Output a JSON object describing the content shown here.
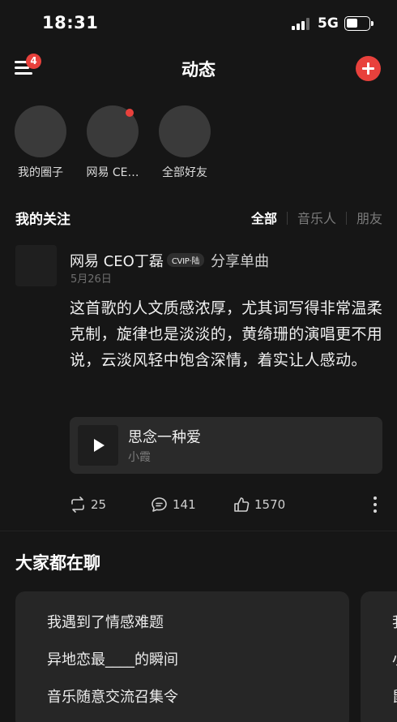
{
  "status_bar": {
    "time": "18:31",
    "network": "5G"
  },
  "header": {
    "title": "动态",
    "notification_count": "4"
  },
  "circles": [
    {
      "label": "我的圈子",
      "has_dot": false
    },
    {
      "label": "网易 CE…",
      "has_dot": true
    },
    {
      "label": "全部好友",
      "has_dot": false
    }
  ],
  "following": {
    "title": "我的关注",
    "filters": [
      "全部",
      "音乐人",
      "朋友"
    ],
    "active_filter": "全部"
  },
  "post": {
    "author": "网易 CEO丁磊",
    "vip_tag": "CVIP·陆",
    "action": "分享单曲",
    "date": "5月26日",
    "text": "这首歌的人文质感浓厚，尤其词写得非常温柔克制，旋律也是淡淡的，黄绮珊的演唱更不用说，云淡风轻中饱含深情，着实让人感动。",
    "song": {
      "title": "思念一种爱",
      "artist": "小霞"
    },
    "reposts": "25",
    "comments": "141",
    "likes": "1570"
  },
  "chat_section": {
    "title": "大家都在聊",
    "topics": [
      "我遇到了情感难题",
      "异地恋最____的瞬间",
      "音乐随意交流召集令"
    ],
    "second_card_fragments": [
      "我",
      "小",
      "鼠"
    ]
  },
  "colors": {
    "accent": "#e8413c",
    "background": "#161616",
    "card": "#262626"
  },
  "icons": [
    "menu-icon",
    "add-icon",
    "play-icon",
    "repost-icon",
    "comment-icon",
    "like-icon",
    "more-icon"
  ]
}
